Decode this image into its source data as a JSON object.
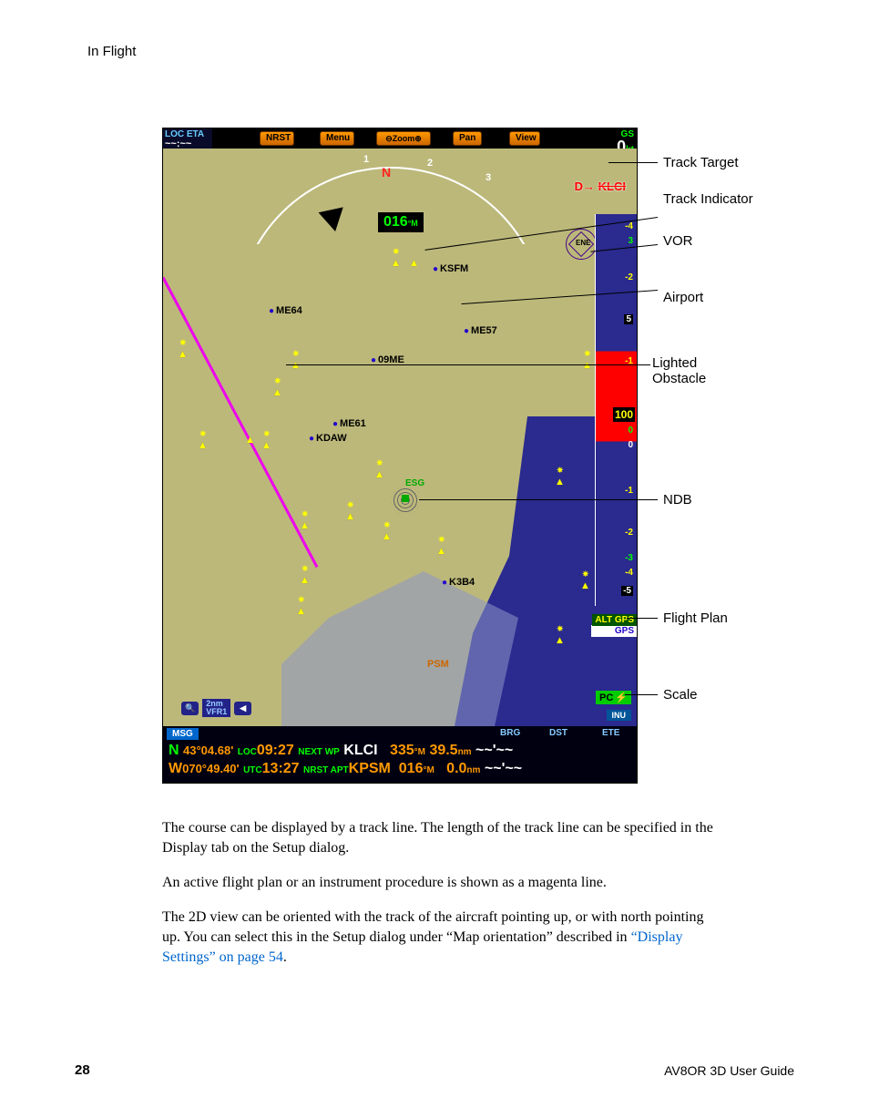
{
  "header": {
    "title": "In Flight"
  },
  "toolbar": {
    "loc_eta_label": "LOC ETA",
    "loc_eta_value": "~~:~~",
    "nrst": "NRST",
    "menu": "Menu",
    "zoom": "⊖Zoom⊕",
    "pan": "Pan",
    "view": "View",
    "gs_label": "GS",
    "gs_value": "0",
    "gs_unit": "kt"
  },
  "map": {
    "north": "N",
    "heading": "016",
    "heading_unit": "°M",
    "ticks": [
      "1",
      "2",
      "3"
    ],
    "target_prefix": "D→",
    "target": "KLCI",
    "vor_label": "ENE",
    "ndb_label": "ESG",
    "airports": {
      "ksfm": "KSFM",
      "me64": "ME64",
      "me57": "ME57",
      "me09": "09ME",
      "me61": "ME61",
      "kdaw": "KDAW",
      "k3b4": "K3B4",
      "psm": "PSM"
    },
    "alt_gps": {
      "alt": "ALT GPS",
      "gps": "GPS"
    },
    "pc": "PC",
    "inu": "INU",
    "scale_mag": "🔍",
    "scale_value": "2",
    "scale_unit": "nm",
    "scale_mode": "VFR1",
    "scale_arrow": "◀",
    "vsi_hundred": "100",
    "vsi_ticks": [
      "-4",
      "3",
      "-2",
      "5",
      "-1",
      "0",
      "0",
      "-1",
      "-2",
      "-3",
      "-4",
      "-5"
    ]
  },
  "databar": {
    "msg": "MSG",
    "labels": {
      "brg": "BRG",
      "dst": "DST",
      "ete": "ETE"
    },
    "row1": {
      "ns": "N",
      "lat": "43°04.68'",
      "loc_l": "LOC",
      "loc": "09:27",
      "nwp_l": "NEXT WP",
      "nwp": "KLCI",
      "brg": "335",
      "brg_u": "°M",
      "dst": "39.5",
      "dst_u": "nm",
      "ete": "~~'~~"
    },
    "row2": {
      "ew": "W",
      "lon": "070°49.40'",
      "utc_l": "UTC",
      "utc": "13:27",
      "nap_l": "NRST APT",
      "nap": "KPSM",
      "brg": "016",
      "brg_u": "°M",
      "dst": "0.0",
      "dst_u": "nm",
      "ete": "~~'~~"
    }
  },
  "callouts": {
    "track_target": "Track Target",
    "track_indicator": "Track Indicator",
    "vor": "VOR",
    "airport": "Airport",
    "lighted_obstacle_l1": "Lighted",
    "lighted_obstacle_l2": "Obstacle",
    "ndb": "NDB",
    "flight_plan": "Flight Plan",
    "scale": "Scale"
  },
  "paragraphs": {
    "p1": "The course can be displayed by a track line. The length of the track line can be specified in the Display tab on the Setup dialog.",
    "p2": "An active flight plan or an instrument procedure is shown as a magenta line.",
    "p3a": "The 2D view can be oriented with the track of the aircraft pointing up, or with north pointing up. You can select this in the Setup dialog under “Map orientation” described in ",
    "p3_link": "“Display Settings” on page 54",
    "p3b": "."
  },
  "footer": {
    "page": "28",
    "guide": "AV8OR 3D User Guide"
  }
}
